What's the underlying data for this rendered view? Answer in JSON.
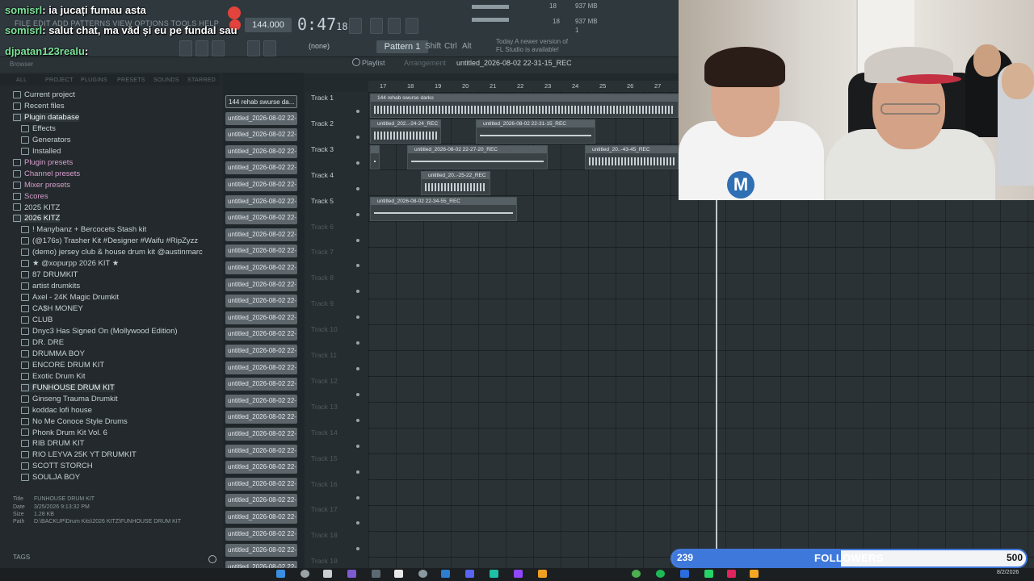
{
  "app": {
    "menu": "FILE EDIT ADD PATTERNS VIEW OPTIONS TOOLS HELP",
    "tempo": "144.000",
    "time_main": "0:47",
    "time_sub": "18",
    "pattern": "Pattern 1",
    "snap": "(none)",
    "keys": [
      "Shift",
      "Ctrl",
      "Alt"
    ],
    "new_version": "Today  A newer version of FL Studio is available!",
    "cpu": "18",
    "mem": "937 MB",
    "cpu2": "18",
    "mem2": "937 MB",
    "mem3": "1"
  },
  "chat": [
    {
      "user": "somisrl",
      "text": ": ia jucați fumau asta"
    },
    {
      "user": "somisrl",
      "text": ": salut chat, ma văd și eu pe fundal sau"
    },
    {
      "user": "djpatan123realu",
      "text": ":"
    }
  ],
  "browser": {
    "header": "Browser",
    "tabs": [
      "ALL",
      "PROJECT",
      "PLUGINS",
      "PRESETS",
      "SOUNDS",
      "STARRED"
    ],
    "tree": [
      {
        "label": "Current project",
        "type": "root"
      },
      {
        "label": "Recent files",
        "type": "root"
      },
      {
        "label": "Plugin database",
        "type": "root",
        "highlight": true
      },
      {
        "label": "Effects",
        "type": "sub"
      },
      {
        "label": "Generators",
        "type": "sub"
      },
      {
        "label": "Installed",
        "type": "sub"
      },
      {
        "label": "Plugin presets",
        "type": "pink"
      },
      {
        "label": "Channel presets",
        "type": "pink"
      },
      {
        "label": "Mixer presets",
        "type": "pink"
      },
      {
        "label": "Scores",
        "type": "pink"
      },
      {
        "label": "2025 KITZ",
        "type": "root"
      },
      {
        "label": "2026 KITZ",
        "type": "root",
        "highlight": true
      },
      {
        "label": "! Manybanz + Bercocets Stash kit",
        "type": "kit"
      },
      {
        "label": "(@176s) Trasher Kit #Designer #Waifu #RipZyzz",
        "type": "kit"
      },
      {
        "label": "(demo) jersey club & house drum kit @austinmarc",
        "type": "kit"
      },
      {
        "label": "★ @xopurpp 2026 KIT ★",
        "type": "kit"
      },
      {
        "label": "87 DRUMKIT",
        "type": "kit"
      },
      {
        "label": "artist drumkits",
        "type": "kit"
      },
      {
        "label": "Axel - 24K Magic Drumkit",
        "type": "kit"
      },
      {
        "label": "CA$H MONEY",
        "type": "kit"
      },
      {
        "label": "CLUB",
        "type": "kit"
      },
      {
        "label": "Dnyc3 Has Signed On (Mollywood Edition)",
        "type": "kit"
      },
      {
        "label": "DR. DRE",
        "type": "kit"
      },
      {
        "label": "DRUMMA BOY",
        "type": "kit"
      },
      {
        "label": "ENCORE DRUM KIT",
        "type": "kit"
      },
      {
        "label": "Exotic Drum Kit",
        "type": "kit"
      },
      {
        "label": "FUNHOUSE DRUM KIT",
        "type": "kit",
        "highlight": true
      },
      {
        "label": "Ginseng Trauma Drumkit",
        "type": "kit"
      },
      {
        "label": "koddac lofi house",
        "type": "kit"
      },
      {
        "label": "No Me Conoce Style Drums",
        "type": "kit"
      },
      {
        "label": "Phonk Drum Kit Vol. 6",
        "type": "kit"
      },
      {
        "label": "RIB DRUM KIT",
        "type": "kit"
      },
      {
        "label": "RIO LEYVA 25K YT DRUMKIT",
        "type": "kit"
      },
      {
        "label": "SCOTT STORCH",
        "type": "kit"
      },
      {
        "label": "SOULJA BOY",
        "type": "kit"
      }
    ],
    "info": {
      "title_label": "Title",
      "title": "FUNHOUSE DRUM KIT",
      "date_label": "Date",
      "date": "3/25/2026 9:13:32 PM",
      "size_label": "Size",
      "size": "1.28 KB",
      "path_label": "Path",
      "path": "D:\\BACKUP\\Drum Kits\\2026 KITZ\\FUNHOUSE DRUM KIT"
    },
    "tags": "TAGS"
  },
  "clips": [
    "144 rehab swurse da...",
    "untitled_2026-08-02 22-",
    "untitled_2026-08-02 22-",
    "untitled_2026-08-02 22-",
    "untitled_2026-08-02 22-",
    "untitled_2026-08-02 22-",
    "untitled_2026-08-02 22-",
    "untitled_2026-08-02 22-",
    "untitled_2026-08-02 22-",
    "untitled_2026-08-02 22-",
    "untitled_2026-08-02 22-",
    "untitled_2026-08-02 22-",
    "untitled_2026-08-02 22-",
    "untitled_2026-08-02 22-",
    "untitled_2026-08-02 22-",
    "untitled_2026-08-02 22-",
    "untitled_2026-08-02 22-",
    "untitled_2026-08-02 22-",
    "untitled_2026-08-02 22-",
    "untitled_2026-08-02 22-",
    "untitled_2026-08-02 22-",
    "untitled_2026-08-02 22-",
    "untitled_2026-08-02 22-",
    "untitled_2026-08-02 22-",
    "untitled_2026-08-02 22-",
    "untitled_2026-08-02 22-",
    "untitled_2026-08-02 22-",
    "untitled_2026-08-02 22-",
    "untitled_2026-08-02 22-"
  ],
  "playlist": {
    "title": "Playlist",
    "mode": "Arrangement",
    "file": "untitled_2026-08-02 22-31-15_REC",
    "ruler": [
      "17",
      "18",
      "19",
      "20",
      "21",
      "22",
      "23",
      "24",
      "25",
      "26",
      "27"
    ],
    "tracks": [
      "Track 1",
      "Track 2",
      "Track 3",
      "Track 4",
      "Track 5",
      "Track 6",
      "Track 7",
      "Track 8",
      "Track 9",
      "Track 10",
      "Track 11",
      "Track 12",
      "Track 13",
      "Track 14",
      "Track 15",
      "Track 16",
      "Track 17",
      "Track 18",
      "Track 19"
    ],
    "audio_clips": [
      "144 rehab swurse darko",
      "untitled_202..-24-24_REC",
      "untitled_2026-08-02 22-31-15_REC",
      "untitled_2026-08-02 22-27-20_REC",
      "untitled_20..-43-45_REC",
      "untitled_20..-25-22_REC",
      "untitled_2026-08-02 22-34-55_REC"
    ]
  },
  "stream": {
    "followers_current": "239",
    "followers_label": "FOLLOWERS",
    "followers_goal": "500",
    "followers_fraction": 0.478,
    "date": "8/2/2026"
  }
}
